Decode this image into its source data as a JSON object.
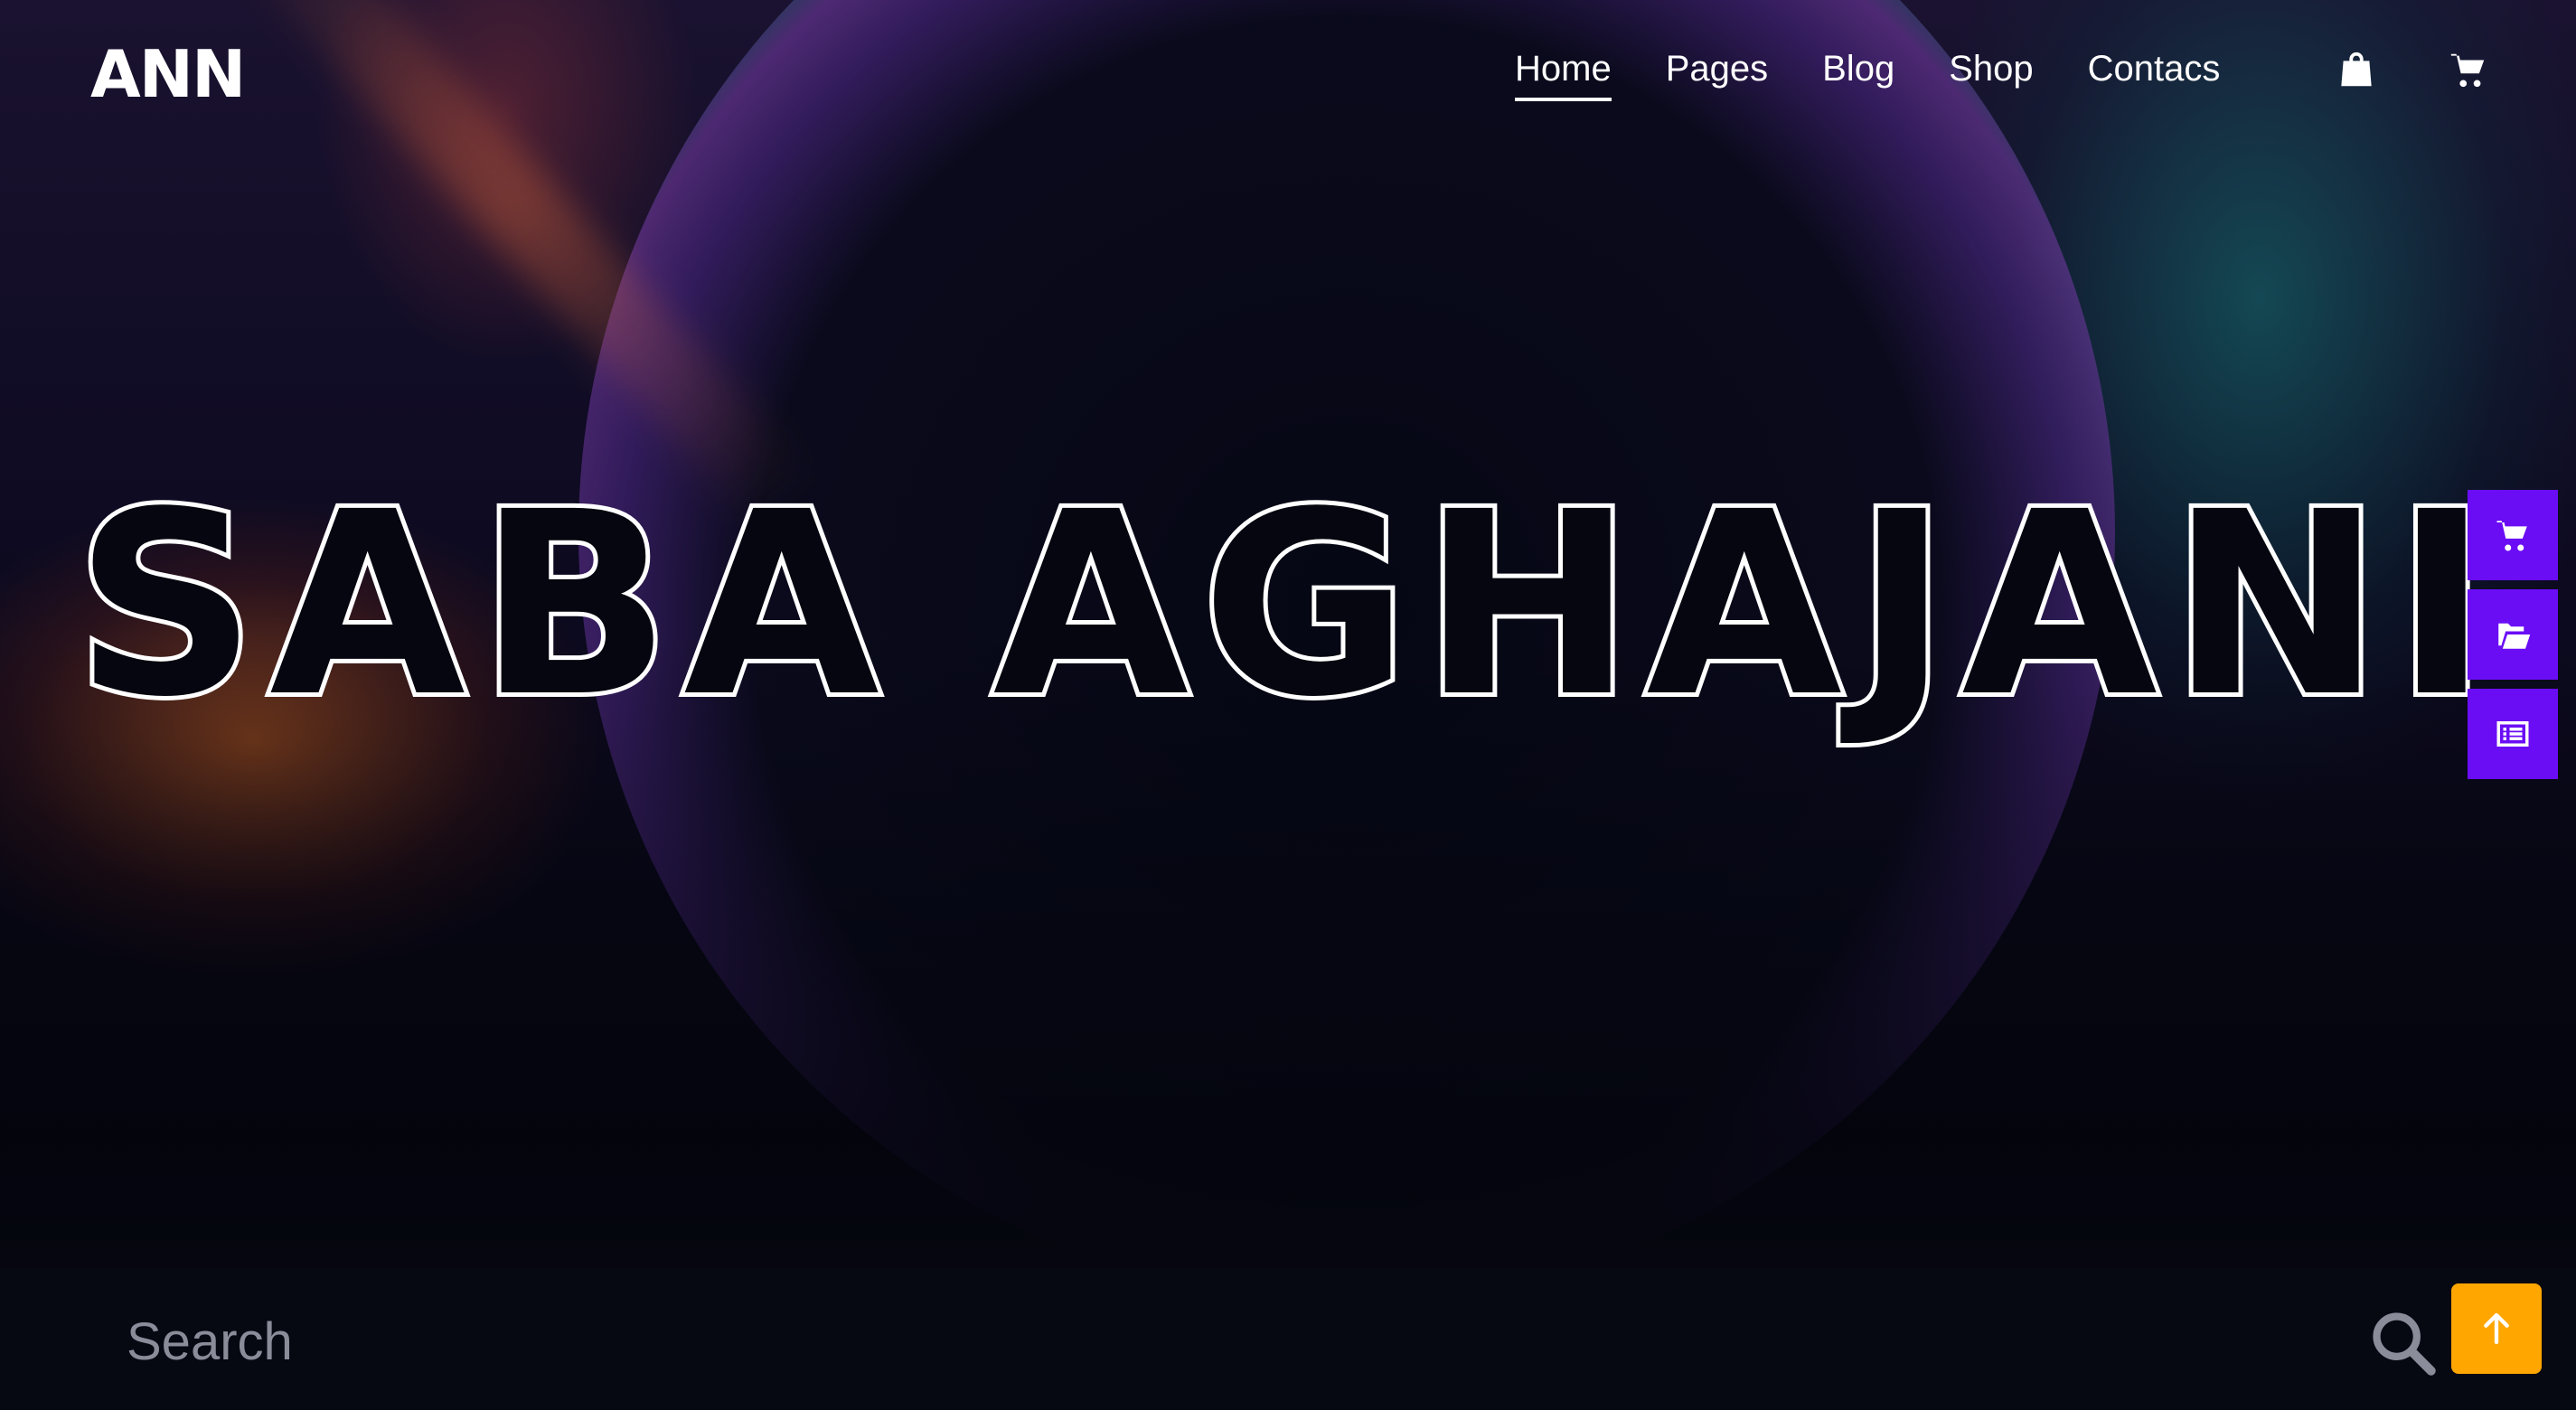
{
  "header": {
    "logo": "ANN",
    "nav": [
      {
        "label": "Home",
        "active": true
      },
      {
        "label": "Pages"
      },
      {
        "label": "Blog"
      },
      {
        "label": "Shop"
      },
      {
        "label": "Contacs"
      }
    ],
    "icons": [
      "shopping-bag-icon",
      "cart-icon"
    ]
  },
  "hero": {
    "title": "SABA AGHAJANI"
  },
  "side_actions": [
    "cart-icon",
    "open-folder-icon",
    "list-icon"
  ],
  "search": {
    "placeholder": "Search",
    "value": ""
  },
  "colors": {
    "side_button": "#6a0df5",
    "to_top_button": "#ffa600",
    "background": "#05060f"
  },
  "back_to_top": {
    "icon": "arrow-up-icon"
  }
}
